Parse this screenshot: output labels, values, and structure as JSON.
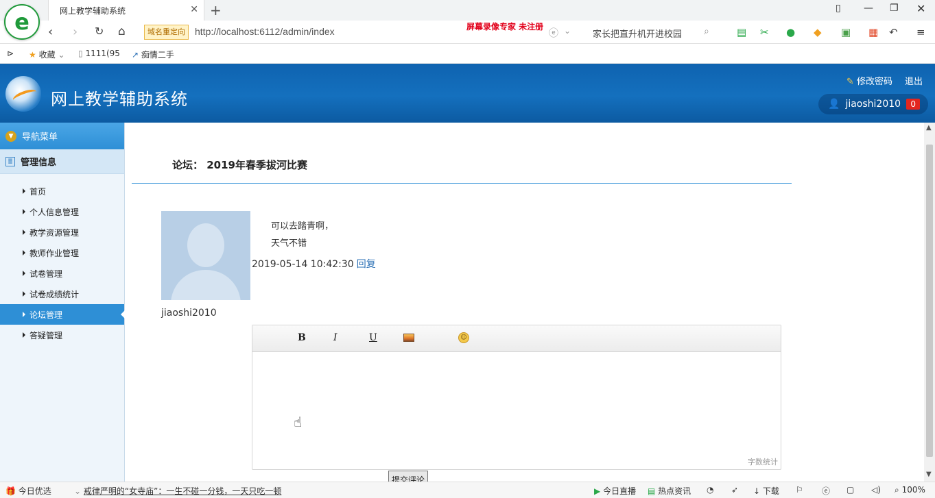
{
  "browser": {
    "tab_title": "网上教学辅助系统",
    "redirect_badge": "域名重定向",
    "url": "http://localhost:6112/admin/index",
    "watermark": "屏幕录像专家  未注册",
    "search_text": "家长把直升机开进校园",
    "bookmarks": {
      "favorites": "收藏",
      "item1": "1111(95",
      "item2": "痴情二手"
    }
  },
  "header": {
    "app_title": "网上教学辅助系统",
    "change_password": "修改密码",
    "logout": "退出",
    "username": "jiaoshi2010",
    "notification_count": "0"
  },
  "sidebar": {
    "nav_title": "导航菜单",
    "group_title": "管理信息",
    "items": [
      {
        "label": "首页"
      },
      {
        "label": "个人信息管理"
      },
      {
        "label": "教学资源管理"
      },
      {
        "label": "教师作业管理"
      },
      {
        "label": "试卷管理"
      },
      {
        "label": "试卷成绩统计"
      },
      {
        "label": "论坛管理"
      },
      {
        "label": "答疑管理"
      }
    ]
  },
  "main": {
    "title": "论坛： 2019年春季拔河比赛",
    "post": {
      "line1": "可以去踏青啊，",
      "line2": "天气不错",
      "timestamp": "2019-05-14 10:42:30",
      "reply_link": "回复",
      "author": "jiaoshi2010"
    },
    "editor": {
      "bold": "B",
      "italic": "I",
      "underline": "U",
      "word_count": "字数统计"
    },
    "submit_label": "提交评论"
  },
  "statusbar": {
    "left_label": "今日优选",
    "news": "戒律严明的“女寺庙”：一生不碰一分钱，一天只吃一顿",
    "live": "今日直播",
    "hot": "热点资讯",
    "download": "下载",
    "zoom": "100%"
  }
}
